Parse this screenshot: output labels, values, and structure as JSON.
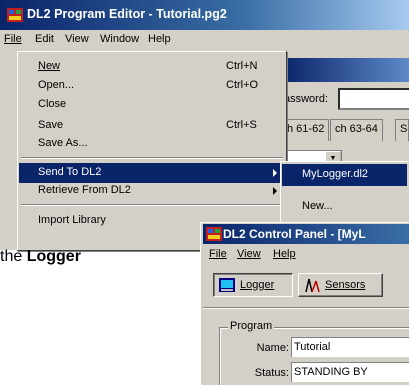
{
  "main_window": {
    "title": "DL2 Program Editor - Tutorial.pg2",
    "menu": [
      {
        "label": "File"
      },
      {
        "label": "Edit"
      },
      {
        "label": "View"
      },
      {
        "label": "Window"
      },
      {
        "label": "Help"
      }
    ],
    "password_label": "assword:",
    "channel_tabs": [
      "h 61-62",
      "ch 63-64",
      "S"
    ]
  },
  "file_menu": {
    "new_label": "New",
    "new_accel": "Ctrl+N",
    "open_label": "Open...",
    "open_accel": "Ctrl+O",
    "close_label": "Close",
    "save_label": "Save",
    "save_accel": "Ctrl+S",
    "save_as_label": "Save As...",
    "send_label": "Send To DL2",
    "retrieve_label": "Retrieve From DL2",
    "import_label": "Import Library"
  },
  "send_submenu": {
    "item1": "MyLogger.dl2",
    "item2": "New..."
  },
  "caption": {
    "prefix": "the",
    "bold": "Logger"
  },
  "control_panel": {
    "title": "DL2 Control Panel - [MyL",
    "menu": [
      {
        "label": "File"
      },
      {
        "label": "View"
      },
      {
        "label": "Help"
      }
    ],
    "toolbar": {
      "logger_label": "Logger",
      "sensors_label": "Sensors"
    },
    "program_group_label": "Program",
    "name_label": "Name:",
    "name_value": "Tutorial",
    "status_label": "Status:",
    "status_value": "STANDING BY"
  },
  "colors": {
    "titlebar_start": "#0a246a",
    "titlebar_end": "#a6caf0",
    "window_face": "#d4d0c8",
    "highlight": "#0a246a"
  }
}
